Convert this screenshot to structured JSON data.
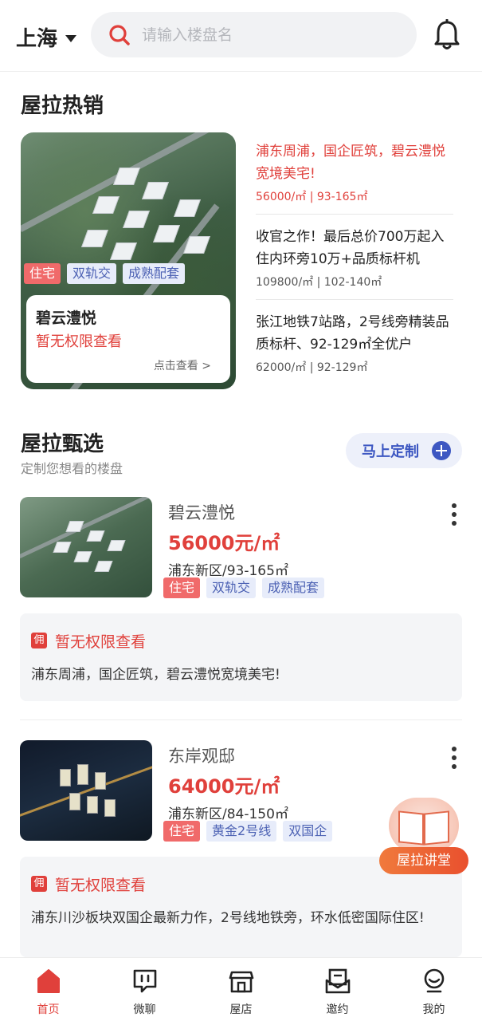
{
  "header": {
    "city": "上海",
    "search_placeholder": "请输入楼盘名"
  },
  "hot": {
    "title": "屋拉热销",
    "card": {
      "tags": [
        "住宅",
        "双轨交",
        "成熟配套"
      ],
      "name": "碧云澧悦",
      "subtitle": "暂无权限查看",
      "link": "点击查看 >"
    },
    "items": [
      {
        "title": "浦东周浦，国企匠筑，碧云澧悦宽境美宅!",
        "price": "56000/㎡ | 93-165㎡",
        "highlight": true
      },
      {
        "title": "收官之作！最后总价700万起入住内环旁10万+品质标杆机",
        "price": "109800/㎡ | 102-140㎡",
        "highlight": false
      },
      {
        "title": "张江地铁7站路，2号线旁精装品质标杆、92-129㎡全优户",
        "price": "62000/㎡ | 92-129㎡",
        "highlight": false
      }
    ]
  },
  "select": {
    "title": "屋拉甄选",
    "subtitle": "定制您想看的楼盘",
    "custom_button": "马上定制",
    "listings": [
      {
        "name": "碧云澧悦",
        "price": "56000元/㎡",
        "area": "浦东新区/93-165㎡",
        "tags": [
          "住宅",
          "双轨交",
          "成熟配套"
        ],
        "badge": "佣",
        "notice_title": "暂无权限查看",
        "notice_text": "浦东周浦，国企匠筑，碧云澧悦宽境美宅!"
      },
      {
        "name": "东岸观邸",
        "price": "64000元/㎡",
        "area": "浦东新区/84-150㎡",
        "tags": [
          "住宅",
          "黄金2号线",
          "双国企"
        ],
        "badge": "佣",
        "notice_title": "暂无权限查看",
        "notice_text": "浦东川沙板块双国企最新力作，2号线地铁旁，环水低密国际住区!"
      }
    ]
  },
  "float": {
    "label": "屋拉讲堂"
  },
  "nav": [
    {
      "label": "首页",
      "icon": "home-icon",
      "active": true
    },
    {
      "label": "微聊",
      "icon": "chat-icon",
      "active": false
    },
    {
      "label": "屋店",
      "icon": "store-icon",
      "active": false
    },
    {
      "label": "邀约",
      "icon": "invite-icon",
      "active": false
    },
    {
      "label": "我的",
      "icon": "profile-icon",
      "active": false
    }
  ],
  "colors": {
    "accent_red": "#e0403b",
    "accent_blue": "#3d57c2",
    "tag_red": "#f06a6a",
    "tag_blue_bg": "#e7ecfa"
  }
}
